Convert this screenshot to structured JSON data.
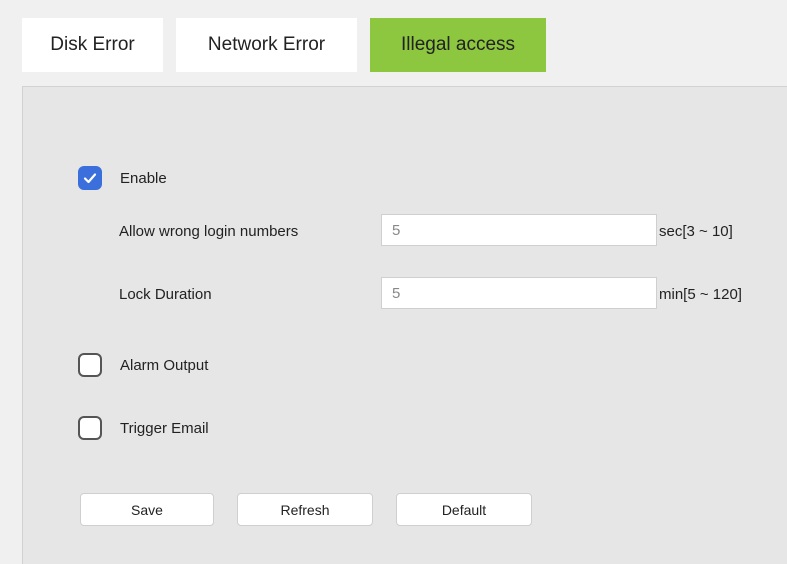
{
  "tabs": [
    {
      "label": "Disk Error",
      "active": false
    },
    {
      "label": "Network Error",
      "active": false
    },
    {
      "label": "Illegal access",
      "active": true
    }
  ],
  "enable": {
    "label": "Enable",
    "checked": true
  },
  "fields": {
    "wrong_login": {
      "label": "Allow wrong login numbers",
      "value": "5",
      "range": "sec[3 ~ 10]"
    },
    "lock_duration": {
      "label": "Lock Duration",
      "value": "5",
      "range": "min[5 ~ 120]"
    }
  },
  "alarm_output": {
    "label": "Alarm Output",
    "checked": false
  },
  "trigger_email": {
    "label": "Trigger Email",
    "checked": false
  },
  "buttons": {
    "save": "Save",
    "refresh": "Refresh",
    "default": "Default"
  },
  "colors": {
    "active_tab": "#8dc63f",
    "checkbox_checked": "#3b6fdc",
    "panel": "#e6e6e6"
  },
  "icons": {
    "check": "checkmark-icon"
  }
}
